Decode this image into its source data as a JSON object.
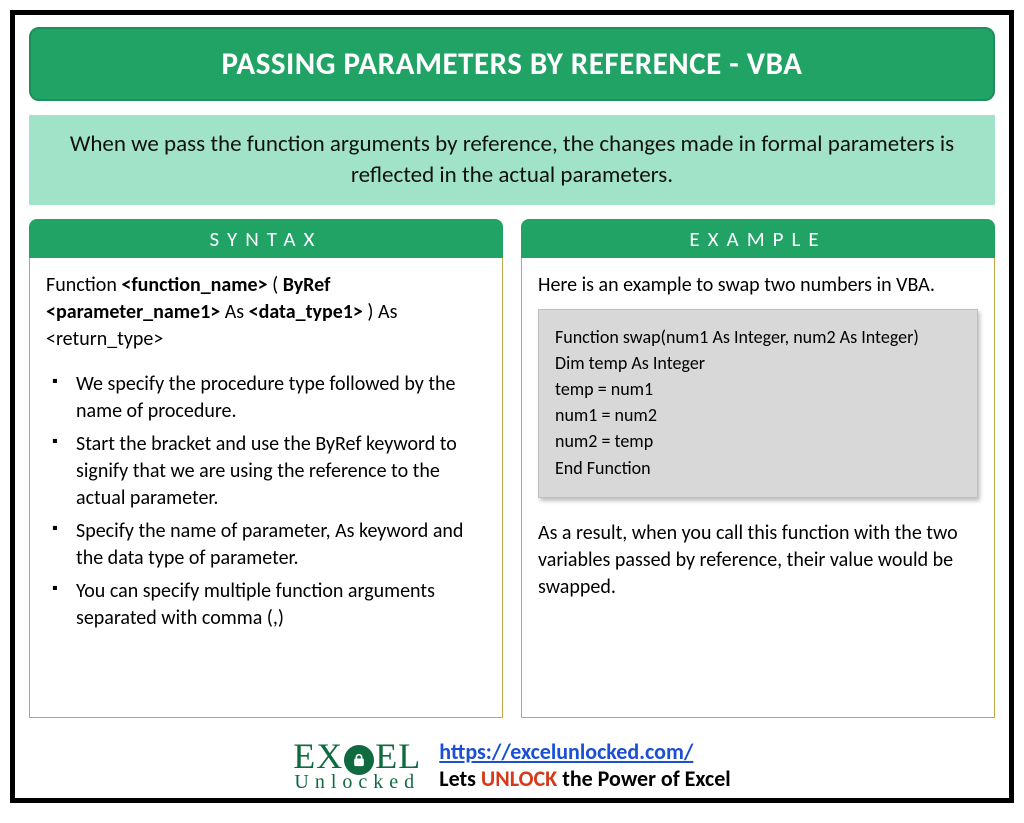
{
  "title": "PASSING PARAMETERS BY REFERENCE - VBA",
  "intro": "When we pass the function arguments by reference, the changes made in formal parameters is reflected in the actual parameters.",
  "syntax": {
    "header": "SYNTAX",
    "line_parts": {
      "p1": "Function ",
      "p2": "<function_name>",
      "p3": " ( ",
      "p4": "ByRef <parameter_name1>",
      "p5": " As ",
      "p6": "<data_type1>",
      "p7": " ) As <return_type>"
    },
    "bullets": [
      "We specify the procedure type followed by the name of procedure.",
      "Start the bracket and use the ByRef keyword to signify that we are using the reference to the actual parameter.",
      "Specify the name of parameter, As keyword and the data type of parameter.",
      "You can specify multiple function arguments separated with comma (,)"
    ]
  },
  "example": {
    "header": "EXAMPLE",
    "intro": "Here is an example to swap two numbers in VBA.",
    "code": [
      "Function swap(num1 As Integer, num2 As Integer)",
      "Dim temp As Integer",
      "temp = num1",
      "num1 = num2",
      "num2 = temp",
      "End Function"
    ],
    "outro": "As a result, when you call this function with the two variables passed by reference, their value would be swapped."
  },
  "footer": {
    "logo_top_left": "EX",
    "logo_top_right": "EL",
    "logo_bottom": "Unlocked",
    "url": "https://excelunlocked.com/",
    "tag_prefix": "Lets ",
    "tag_unlock": "UNLOCK",
    "tag_suffix": " the Power of Excel"
  }
}
